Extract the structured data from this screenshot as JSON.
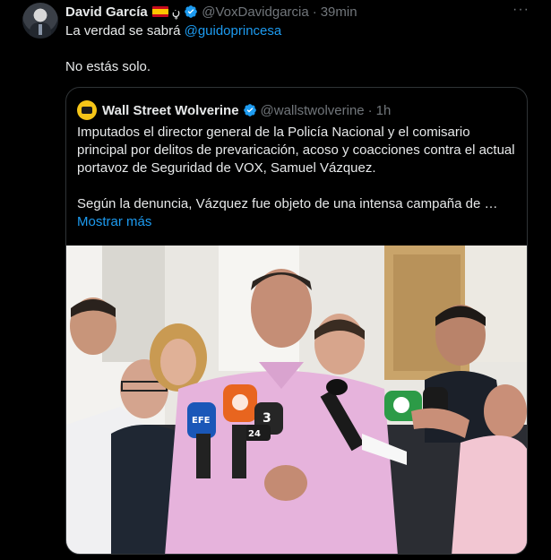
{
  "tweet": {
    "author_name": "David García",
    "author_glyph": "ڼ",
    "handle": "@VoxDavidgarcia",
    "separator": "·",
    "time": "39min",
    "more_label": "···",
    "line1_prefix": "La verdad se sabrá ",
    "line1_mention": "@guidoprincesa",
    "line2": "No estás solo."
  },
  "quote": {
    "author_name": "Wall Street Wolverine",
    "handle": "@wallstwolverine",
    "separator": "·",
    "time": "1h",
    "paragraph1": "Imputados el director general de la Policía Nacional y el comisario principal por delitos de prevaricación, acoso y coacciones contra el actual portavoz de Seguridad de VOX, Samuel Vázquez.",
    "paragraph2": "Según la denuncia, Vázquez fue objeto de una intensa campaña de …",
    "show_more": "Mostrar más"
  },
  "photo": {
    "mic_labels": [
      "EFE",
      "3",
      "24"
    ]
  },
  "colors": {
    "background": "#000000",
    "text": "#e7e9ea",
    "secondary": "#71767b",
    "link": "#1d9bf0",
    "border": "#2f3336"
  },
  "icons": [
    "verified-badge-icon",
    "spain-flag-icon",
    "more-options-icon"
  ]
}
